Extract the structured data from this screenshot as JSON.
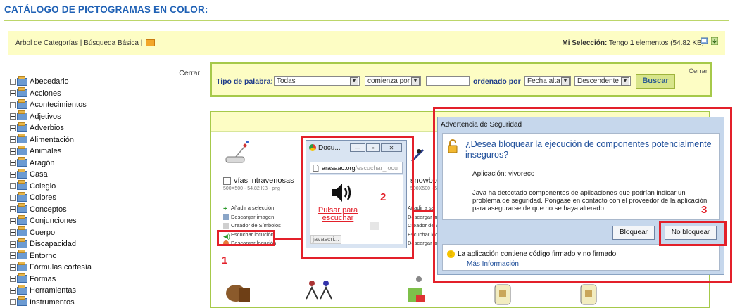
{
  "header": {
    "title": "CATÁLOGO DE PICTOGRAMAS EN COLOR:"
  },
  "topbar": {
    "nav_tree": "Árbol de Categorías",
    "nav_sep": "|",
    "nav_basic": "Búsqueda Básica",
    "selection_label": "Mi Selección:",
    "selection_text_1": "Tengo",
    "selection_count": "1",
    "selection_text_2": "elementos",
    "selection_size": "(54.82 KB)"
  },
  "sidebar": {
    "close": "Cerrar",
    "categories": [
      "Abecedario",
      "Acciones",
      "Acontecimientos",
      "Adjetivos",
      "Adverbios",
      "Alimentación",
      "Animales",
      "Aragón",
      "Casa",
      "Colegio",
      "Colores",
      "Conceptos",
      "Conjunciones",
      "Cuerpo",
      "Discapacidad",
      "Entorno",
      "Fórmulas cortesía",
      "Formas",
      "Herramientas",
      "Instrumentos"
    ]
  },
  "search": {
    "close": "Cerrar",
    "word_type_label": "Tipo de palabra:",
    "word_type_value": "Todas",
    "match_value": "comienza por",
    "text_value": "",
    "order_label": "ordenado por",
    "order_value": "Fecha alta",
    "direction_value": "Descendente",
    "submit": "Buscar"
  },
  "results": {
    "card1": {
      "name": "vías intravenosas",
      "meta": "500X500 - 54.82 KB - png",
      "actions": [
        "Añadir a selección",
        "Descargar imagen",
        "Creador de Símbolos",
        "Escuchar locución",
        "Descargar locución"
      ]
    },
    "card2": {
      "name": "snowbo",
      "meta": "500X500 - 52.7",
      "actions": [
        "Añadir a se",
        "Descargar ima",
        "Creador de S",
        "Escuchar locu",
        "Descargar loc"
      ]
    }
  },
  "popup": {
    "tab_title": "Docu...",
    "url_host": "arasaac.org",
    "url_path": "/escuchar_locu",
    "link_text": "Pulsar para escuchar",
    "status": "javascri..."
  },
  "dialog": {
    "title": "Advertencia de Seguridad",
    "question": "¿Desea bloquear la ejecución de componentes potencialmente inseguros?",
    "application_label": "Aplicación:",
    "application_value": "vivoreco",
    "message": "Java ha detectado componentes de aplicaciones que podrían indicar un problema de seguridad. Póngase en contacto con el proveedor de la aplicación para asegurarse de que no se haya alterado.",
    "block_button": "Bloquear",
    "dont_block_button": "No bloquear",
    "footer_warning": "La aplicación contiene código firmado y no firmado.",
    "more_info": "Más Información"
  },
  "annotations": {
    "n1": "1",
    "n2": "2",
    "n3": "3"
  },
  "colors": {
    "accent_red": "#e3202a",
    "green_border": "#a6c94a",
    "panel_yellow": "#fdfdc4",
    "title_blue": "#1f61b5"
  }
}
